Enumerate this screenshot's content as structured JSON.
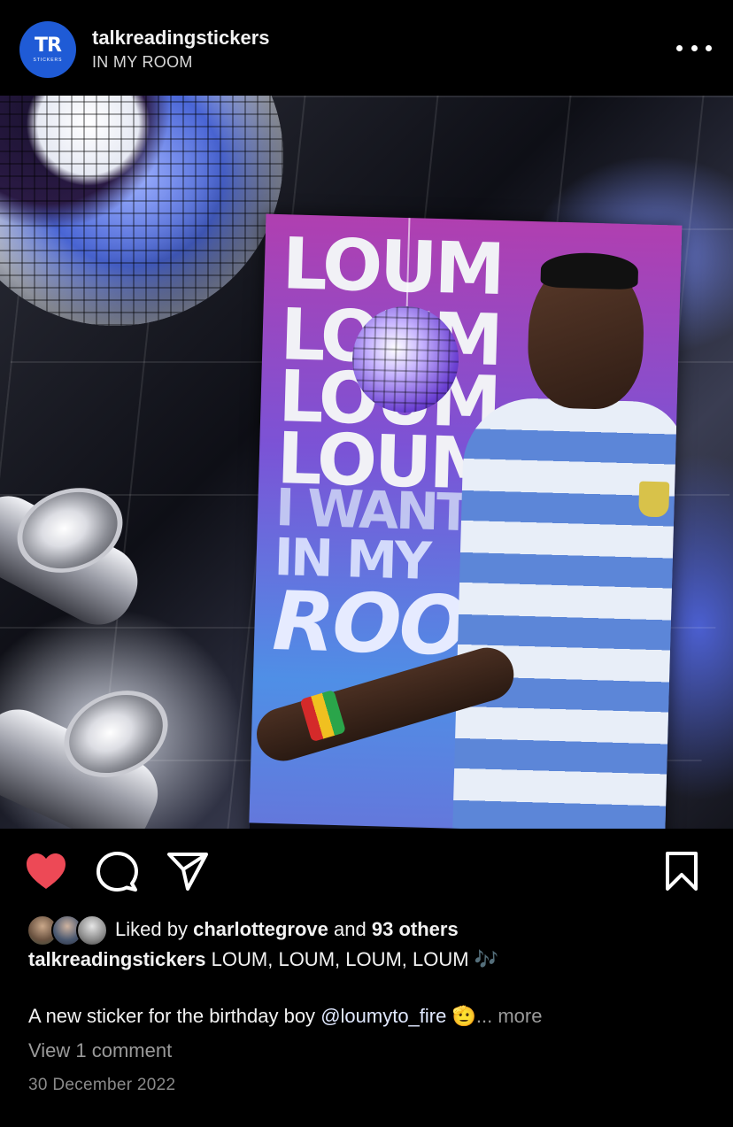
{
  "header": {
    "avatar_logo": "TR",
    "avatar_sub": "STICKERS",
    "username": "talkreadingstickers",
    "location": "IN MY ROOM"
  },
  "post": {
    "poster_lines": [
      "LOUM",
      "LOUM",
      "LOUM",
      "LOUM",
      "I WANT U",
      "IN MY",
      "ROOM"
    ]
  },
  "actions": {
    "like_color": "#ed4956",
    "liked": true
  },
  "likes": {
    "prefix": "Liked by",
    "first_liker": "charlottegrove",
    "joiner": "and",
    "others": "93 others"
  },
  "caption": {
    "username": "talkreadingstickers",
    "headline": "LOUM, LOUM, LOUM, LOUM",
    "headline_emoji": "🎶",
    "body_text": "A new sticker for the birthday boy",
    "mention": "@loumyto_fire",
    "body_emoji": "🫡",
    "more": "... more"
  },
  "comments": {
    "view_label": "View 1 comment"
  },
  "timestamp": "30 December 2022"
}
